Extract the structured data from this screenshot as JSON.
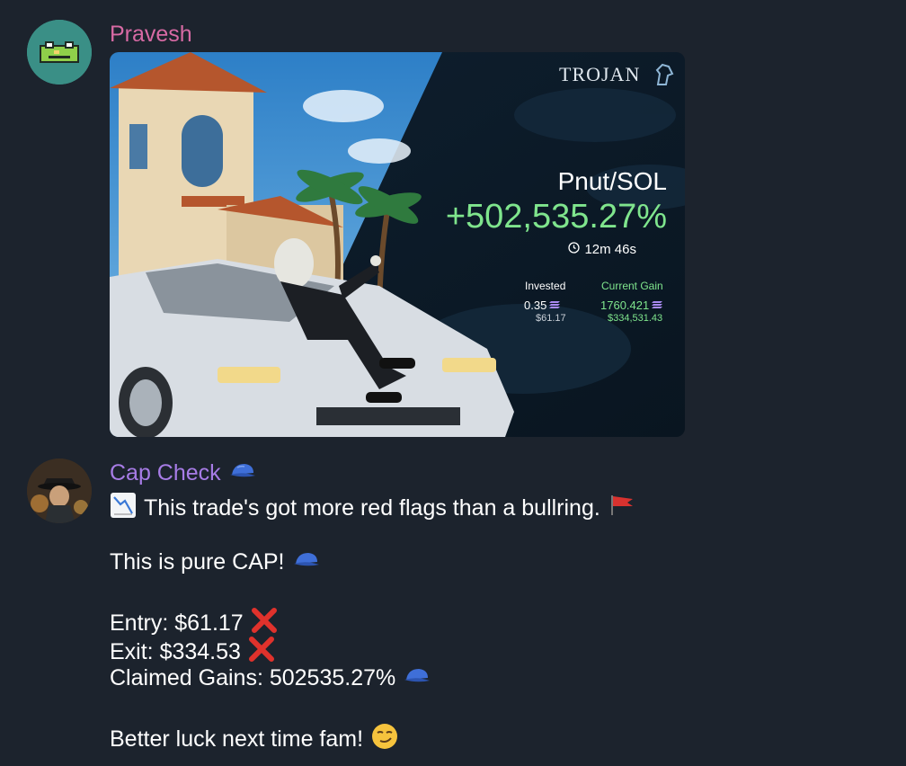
{
  "messages": [
    {
      "sender": "Pravesh",
      "sender_color": "#d76aa4",
      "avatar_icon": "pixel-frog-icon",
      "photo": {
        "brand": "TROJAN",
        "pair": "Pnut/SOL",
        "gain_pct": "+502,535.27%",
        "duration": "12m 46s",
        "invested_label": "Invested",
        "invested_sol": "0.35",
        "invested_usd": "$61.17",
        "current_label": "Current Gain",
        "current_sol": "1760.421",
        "current_usd": "$334,531.43"
      }
    },
    {
      "sender": "Cap Check",
      "sender_color": "#a77ce6",
      "avatar_icon": "detective-avatar-icon",
      "lines": [
        "This trade's got more red flags than a bullring.",
        "This is pure CAP!",
        "Entry: $61.17",
        "Exit: $334.53",
        "Claimed Gains: 502535.27%",
        "Better luck next time fam!"
      ]
    }
  ]
}
